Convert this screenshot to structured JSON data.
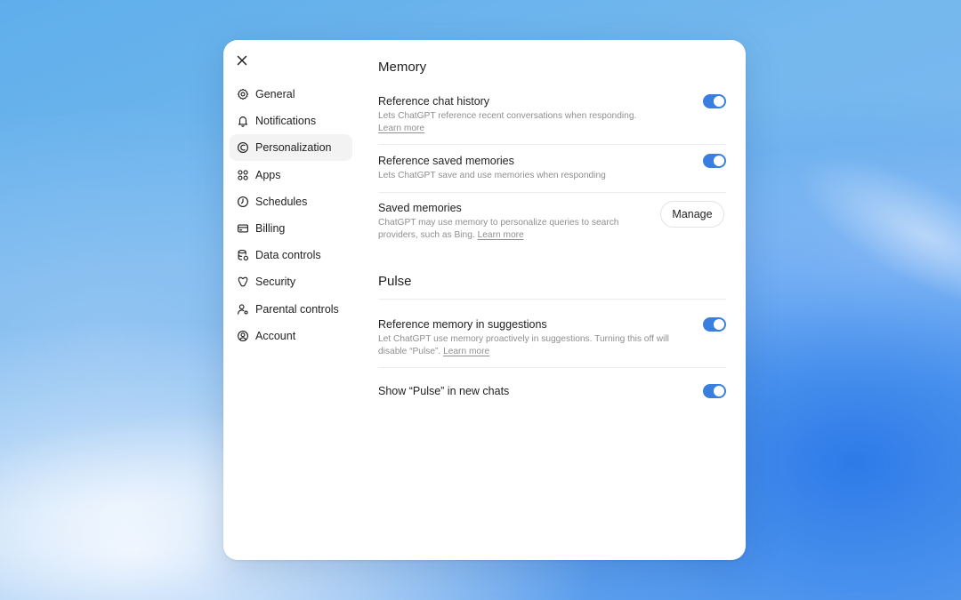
{
  "sidebar": {
    "items": [
      {
        "label": "General",
        "icon": "gear-icon"
      },
      {
        "label": "Notifications",
        "icon": "bell-icon"
      },
      {
        "label": "Personalization",
        "icon": "personalization-icon",
        "active": true
      },
      {
        "label": "Apps",
        "icon": "apps-grid-icon"
      },
      {
        "label": "Schedules",
        "icon": "clock-icon"
      },
      {
        "label": "Billing",
        "icon": "credit-card-icon"
      },
      {
        "label": "Data controls",
        "icon": "database-icon"
      },
      {
        "label": "Security",
        "icon": "shield-icon"
      },
      {
        "label": "Parental controls",
        "icon": "parental-controls-icon"
      },
      {
        "label": "Account",
        "icon": "account-circle-icon"
      }
    ]
  },
  "memory": {
    "title": "Memory",
    "reference_chat_history": {
      "label": "Reference chat history",
      "desc": "Lets ChatGPT reference recent conversations when responding.",
      "link": "Learn more",
      "enabled": true
    },
    "reference_saved_memories": {
      "label": "Reference saved memories",
      "desc": "Lets ChatGPT save and use memories when responding",
      "enabled": true
    },
    "saved_memories": {
      "label": "Saved memories",
      "desc": "ChatGPT may use memory to personalize queries to search providers, such as Bing.",
      "link": "Learn more",
      "button": "Manage"
    }
  },
  "pulse": {
    "title": "Pulse",
    "reference_memory_suggestions": {
      "label": "Reference memory in suggestions",
      "desc": "Let ChatGPT use memory proactively in suggestions. Turning this off will disable “Pulse”.",
      "link": "Learn more",
      "enabled": true
    },
    "show_pulse_new_chats": {
      "label": "Show “Pulse” in new chats",
      "enabled": true
    }
  },
  "colors": {
    "toggle_on": "#3a7fe0",
    "active_nav_bg": "#f3f3f3"
  }
}
